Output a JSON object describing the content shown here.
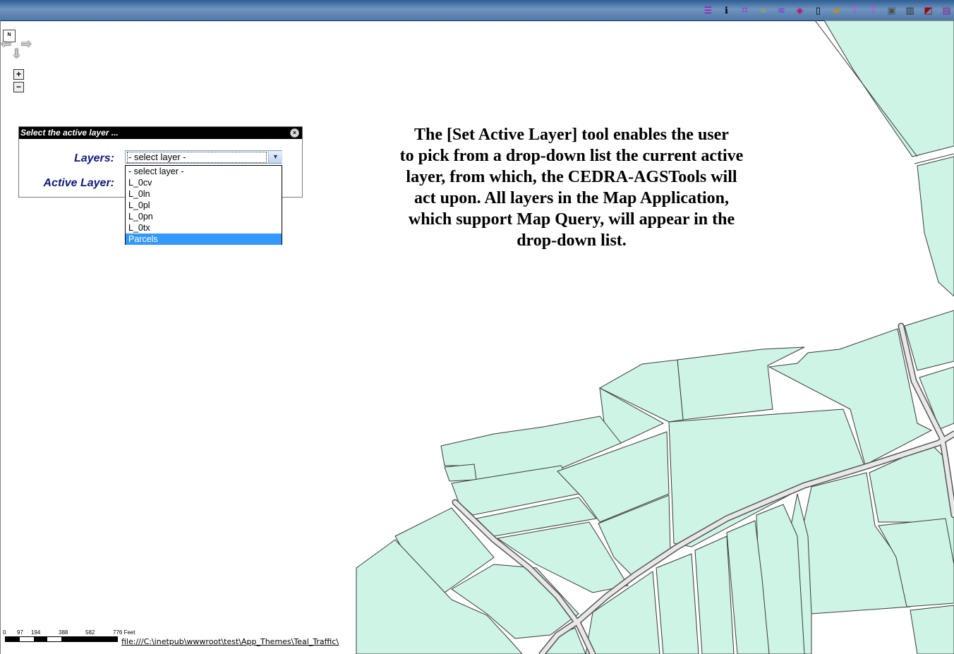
{
  "toolbar": {
    "icons": [
      {
        "name": "layer-list-icon",
        "glyph": "☰",
        "color": "#b000b0"
      },
      {
        "name": "identify-icon",
        "glyph": "ℹ",
        "color": "#000000"
      },
      {
        "name": "select-point-icon",
        "glyph": "⌑",
        "color": "#cc00cc"
      },
      {
        "name": "select-box-icon",
        "glyph": "⌗",
        "color": "#c8b400"
      },
      {
        "name": "layers-stack-icon",
        "glyph": "≋",
        "color": "#8a2be2"
      },
      {
        "name": "eraser-icon",
        "glyph": "◈",
        "color": "#d0006f"
      },
      {
        "name": "page-icon",
        "glyph": "▯",
        "color": "#000000"
      },
      {
        "name": "open-folder-icon",
        "glyph": "▰",
        "color": "#c89000"
      },
      {
        "name": "query-icon",
        "glyph": "⁑",
        "color": "#d040d0"
      },
      {
        "name": "query-clear-icon",
        "glyph": "⁑",
        "color": "#d040d0"
      },
      {
        "name": "box-icon",
        "glyph": "▣",
        "color": "#505050"
      },
      {
        "name": "table-icon",
        "glyph": "▥",
        "color": "#303030"
      },
      {
        "name": "chart-icon",
        "glyph": "◩",
        "color": "#a00000"
      },
      {
        "name": "report-icon",
        "glyph": "▤",
        "color": "#902090"
      }
    ]
  },
  "nav": {
    "north_label": "N",
    "zoom_in": "+",
    "zoom_out": "−"
  },
  "dialog": {
    "title": "Select the active layer ...",
    "close": "×",
    "layers_label": "Layers:",
    "active_label": "Active Layer:",
    "select_value": "- select layer -",
    "dropdown_arrow": "▼",
    "options": [
      {
        "label": "- select layer -",
        "selected": false
      },
      {
        "label": "L_0cv",
        "selected": false
      },
      {
        "label": "L_0ln",
        "selected": false
      },
      {
        "label": "L_0pl",
        "selected": false
      },
      {
        "label": "L_0pn",
        "selected": false
      },
      {
        "label": "L_0tx",
        "selected": false
      },
      {
        "label": "Parcels",
        "selected": true
      }
    ]
  },
  "description": {
    "lines": [
      "The [Set Active Layer] tool enables the user",
      "to pick from a drop-down list the current active",
      "layer, from which, the CEDRA-AGSTools will",
      "act upon.  All layers in the Map Application,",
      "which support Map Query, will appear in the",
      "drop-down list."
    ]
  },
  "scalebar": {
    "labels": [
      "0",
      "97",
      "194",
      "388",
      "582",
      "776 Feet"
    ]
  },
  "footer": {
    "path": "file:///C:\\inetpub\\wwwroot\\test\\App_Themes\\Teal_Traffic\\"
  },
  "colors": {
    "parcel": "#cdf4e4",
    "road": "#e8e8e8",
    "outline": "#3a3a3a"
  }
}
